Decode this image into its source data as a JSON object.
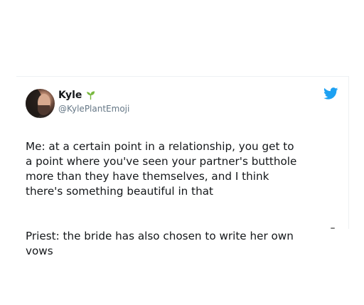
{
  "tweet": {
    "display_name": "Kyle",
    "name_icon": "sprout-icon",
    "handle": "@KylePlantEmoji",
    "brand_icon": "twitter-bird-icon",
    "body": [
      "Me: at a certain point in a relationship, you get to\na point where you've seen your partner's butthole\nmore than they have themselves, and I think\nthere's something beautiful in that",
      "Priest: the bride has also chosen to write her own\nvows"
    ]
  },
  "colors": {
    "name": "#14171a",
    "handle": "#657786",
    "sprout": "#79b83f",
    "twitter_blue": "#1da1f2"
  }
}
